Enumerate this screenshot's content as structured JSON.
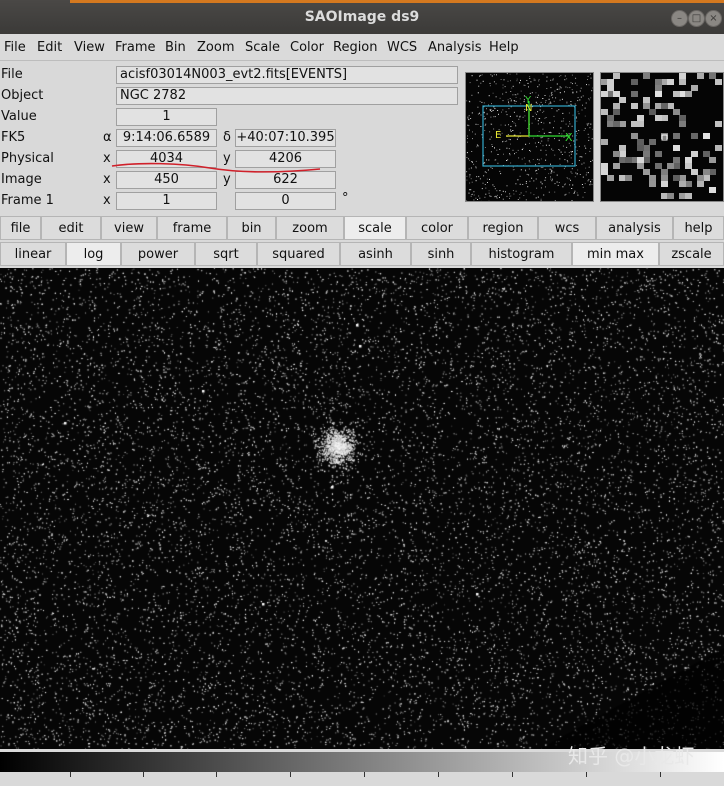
{
  "window": {
    "title": "SAOImage ds9"
  },
  "menu": [
    "File",
    "Edit",
    "View",
    "Frame",
    "Bin",
    "Zoom",
    "Scale",
    "Color",
    "Region",
    "WCS",
    "Analysis",
    "Help"
  ],
  "info": {
    "file_label": "File",
    "file_value": "acisf03014N003_evt2.fits[EVENTS]",
    "object_label": "Object",
    "object_value": "NGC 2782",
    "value_label": "Value",
    "value_value": "1",
    "fk5_label": "FK5",
    "fk5_alpha_symbol": "α",
    "fk5_alpha": "9:14:06.6589",
    "fk5_delta_symbol": "δ",
    "fk5_delta": "+40:07:10.395",
    "physical_label": "Physical",
    "physical_x_label": "x",
    "physical_x": "4034",
    "physical_y_label": "y",
    "physical_y": "4206",
    "image_label": "Image",
    "image_x_label": "x",
    "image_x": "450",
    "image_y_label": "y",
    "image_y": "622",
    "frame_label": "Frame 1",
    "frame_x_label": "x",
    "frame_zoom": "1",
    "frame_angle": "0",
    "degree_symbol": "°"
  },
  "panner": {
    "north_label": "N",
    "east_label": "E",
    "x_label": "X",
    "y_label": "Y"
  },
  "buttonbar_main": [
    "file",
    "edit",
    "view",
    "frame",
    "bin",
    "zoom",
    "scale",
    "color",
    "region",
    "wcs",
    "analysis",
    "help"
  ],
  "buttonbar_main_active": "scale",
  "buttonbar_scale": [
    "linear",
    "log",
    "power",
    "sqrt",
    "squared",
    "asinh",
    "sinh",
    "histogram",
    "min max",
    "zscale"
  ],
  "buttonbar_scale_active": [
    "log",
    "min max"
  ],
  "watermark": "知乎 @小龙虾",
  "colors": {
    "annotation_red": "#d0202a",
    "compass_green": "#33dd33",
    "compass_yellow": "#e8e833",
    "panner_box": "#33aacc"
  },
  "icons": [
    "window-minimize-icon",
    "window-maximize-icon",
    "window-close-icon"
  ]
}
